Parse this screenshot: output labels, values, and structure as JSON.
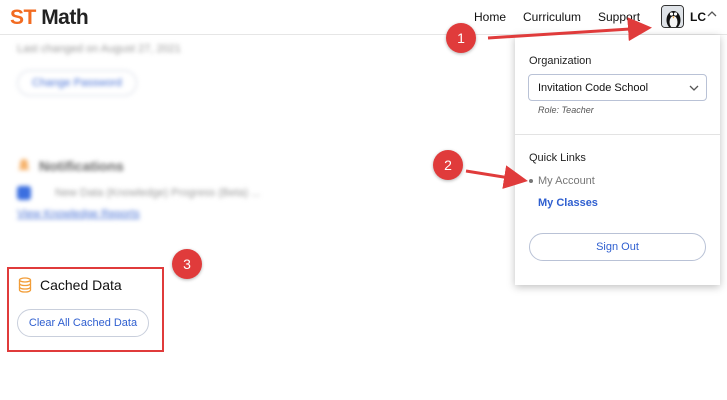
{
  "header": {
    "logo_prefix": "ST",
    "logo_suffix": "Math",
    "nav": [
      "Home",
      "Curriculum",
      "Support"
    ],
    "user_initials": "LC"
  },
  "background": {
    "blurred_note": "Last changed on August 27, 2021",
    "change_password_label": "Change Password",
    "notifications_heading": "Notifications",
    "notification_text": "New Data (Knowledge) Progress (Beta) ...",
    "notification_link": "View Knowledge Reports"
  },
  "cached": {
    "title": "Cached Data",
    "button_label": "Clear All Cached Data"
  },
  "dropdown": {
    "organization_label": "Organization",
    "organization_value": "Invitation Code School",
    "role": "Role: Teacher",
    "quick_links_label": "Quick Links",
    "links": [
      "My Account",
      "My Classes"
    ],
    "sign_out": "Sign Out"
  },
  "annotations": [
    "1",
    "2",
    "3"
  ],
  "colors": {
    "brand_orange": "#f26b21",
    "link_blue": "#2f5fd0",
    "annotation_red": "#e03b3b"
  }
}
